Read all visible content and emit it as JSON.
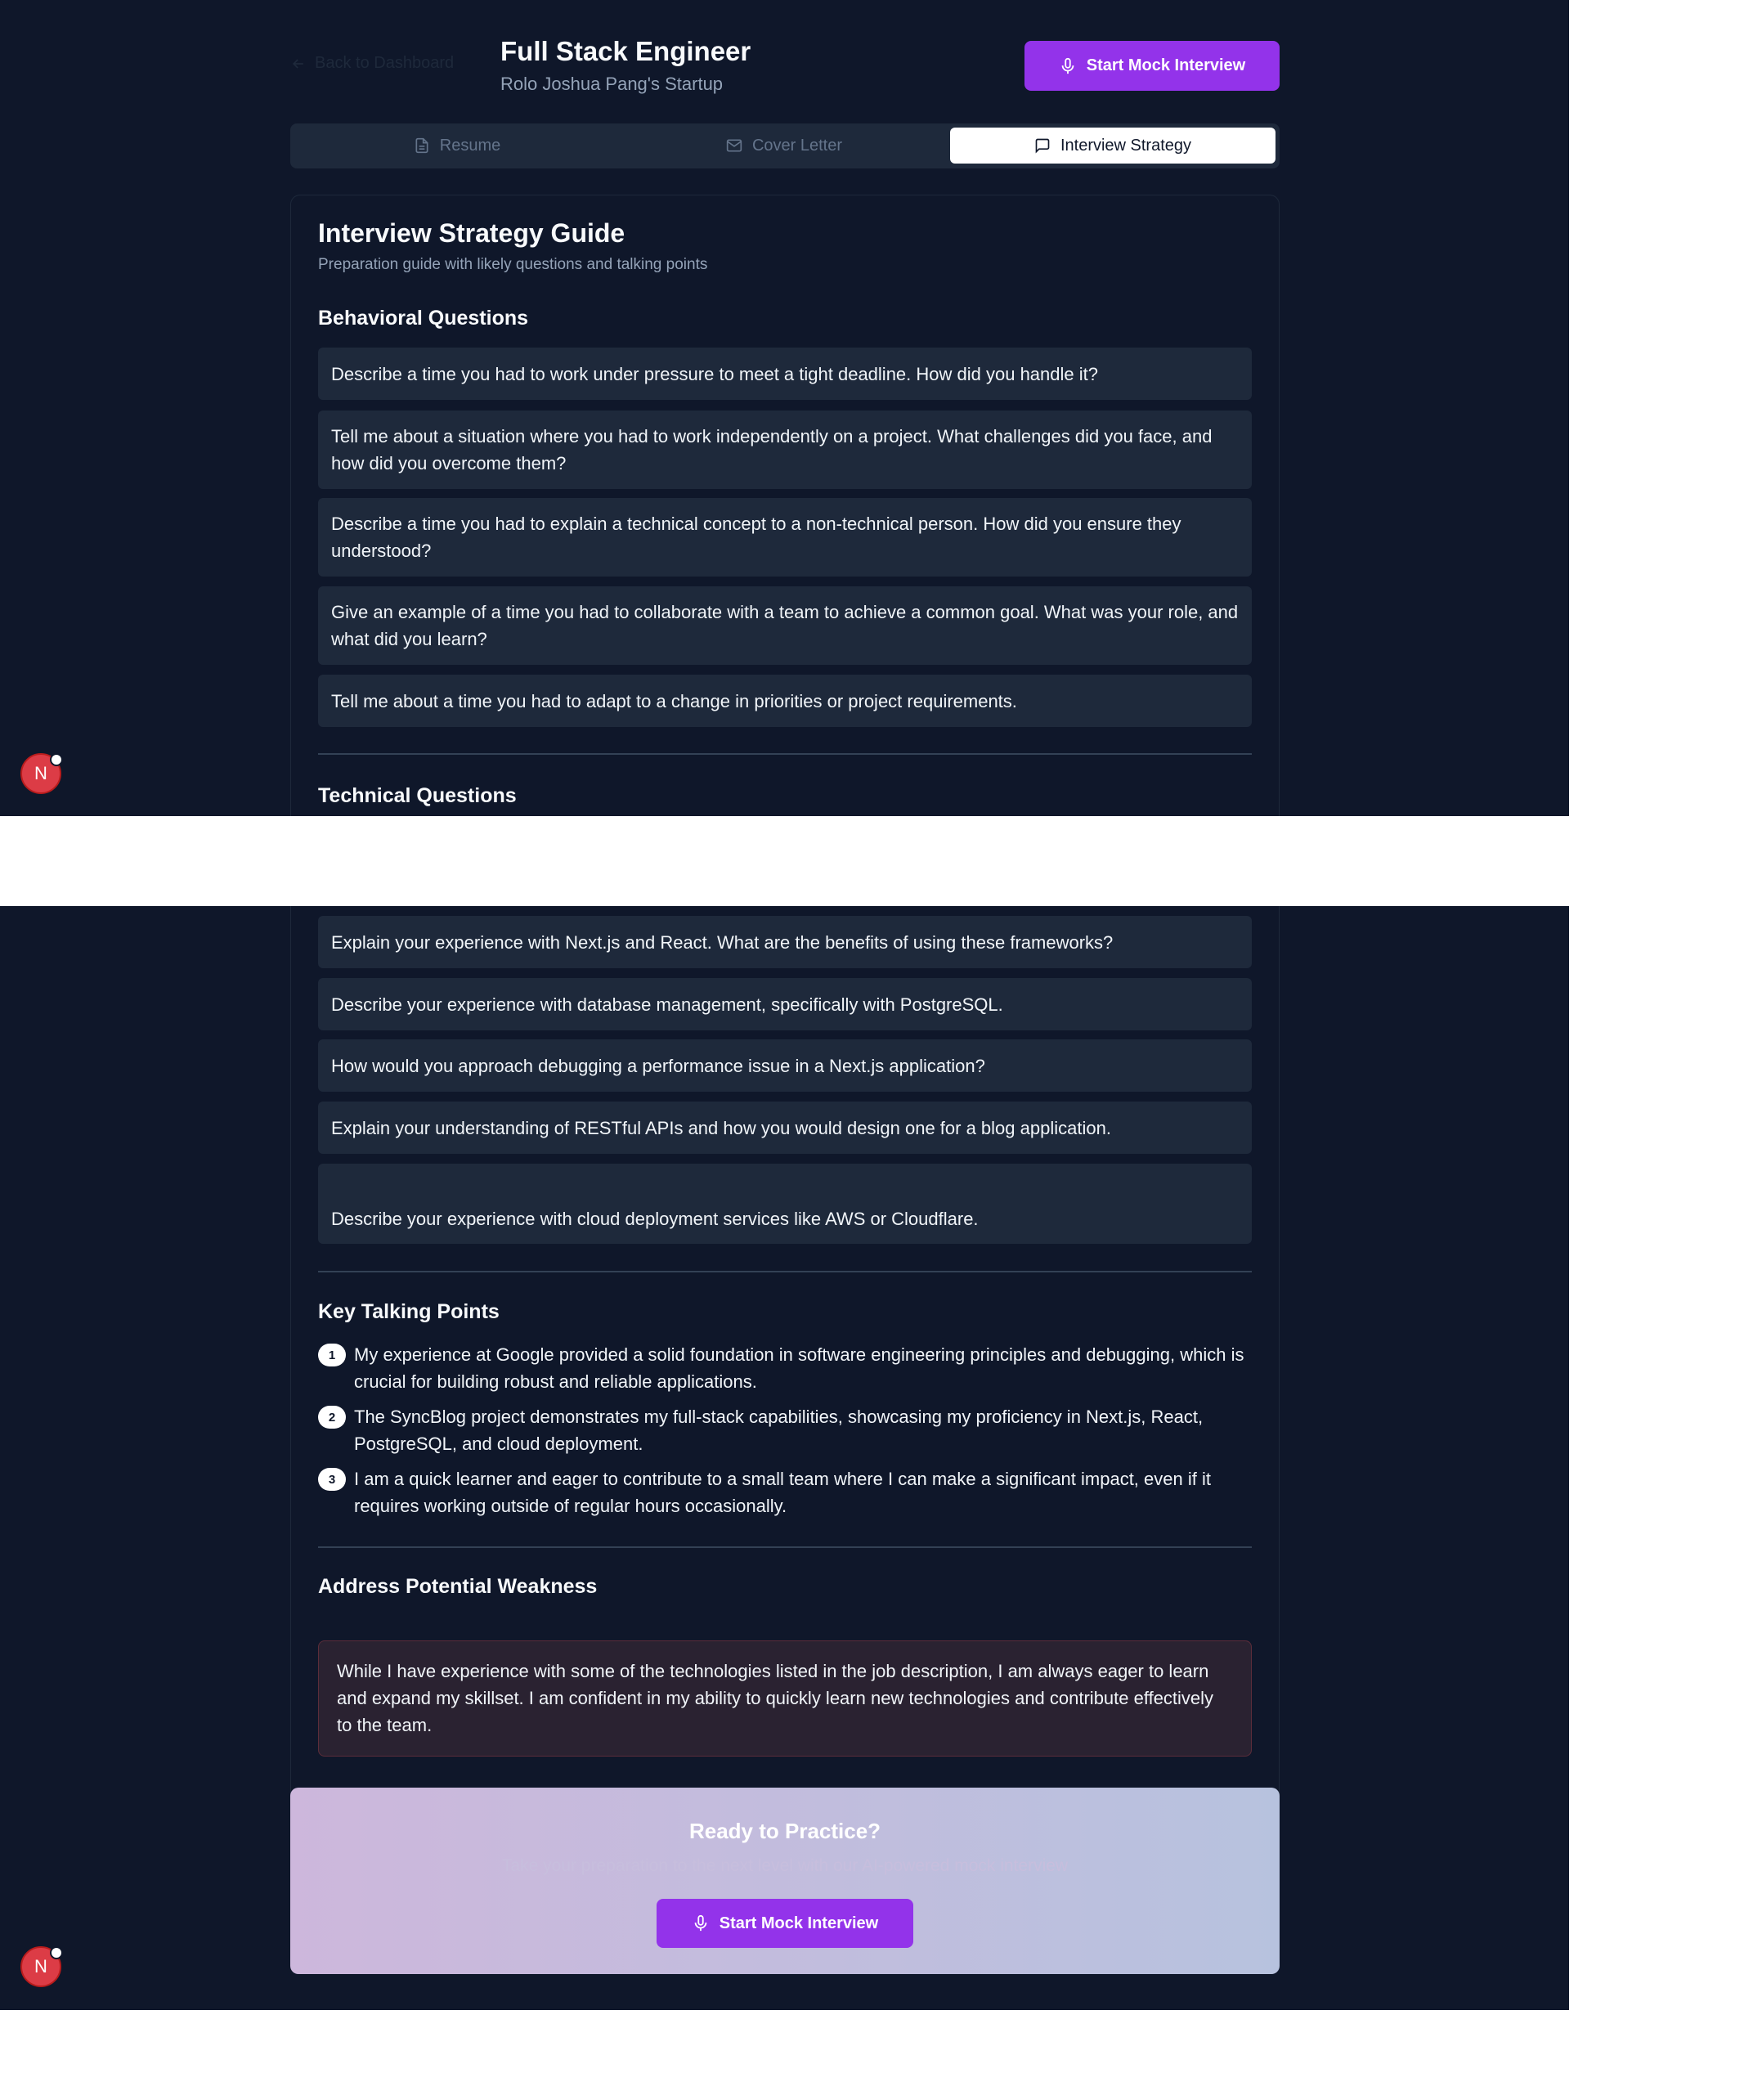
{
  "header": {
    "back_label": "Back to Dashboard",
    "job_title": "Full Stack Engineer",
    "company": "Rolo Joshua Pang's Startup",
    "mock_button": "Start Mock Interview"
  },
  "tabs": [
    {
      "label": "Resume",
      "icon": "file-icon",
      "active": false
    },
    {
      "label": "Cover Letter",
      "icon": "mail-icon",
      "active": false
    },
    {
      "label": "Interview Strategy",
      "icon": "message-icon",
      "active": true
    }
  ],
  "guide": {
    "title": "Interview Strategy Guide",
    "subtitle": "Preparation guide with likely questions and talking points"
  },
  "behavioral": {
    "title": "Behavioral Questions",
    "questions": [
      "Describe a time you had to work under pressure to meet a tight deadline. How did you handle it?",
      "Tell me about a situation where you had to work independently on a project. What challenges did you face, and how did you overcome them?",
      "Describe a time you had to explain a technical concept to a non-technical person. How did you ensure they understood?",
      "Give an example of a time you had to collaborate with a team to achieve a common goal. What was your role, and what did you learn?",
      "Tell me about a time you had to adapt to a change in priorities or project requirements."
    ]
  },
  "technical": {
    "title": "Technical Questions",
    "questions": [
      "Explain your experience with Next.js and React. What are the benefits of using these frameworks?",
      "Describe your experience with database management, specifically with PostgreSQL.",
      "How would you approach debugging a performance issue in a Next.js application?",
      "Explain your understanding of RESTful APIs and how you would design one for a blog application.",
      "Describe your experience with cloud deployment services like AWS or Cloudflare."
    ]
  },
  "talking_points": {
    "title": "Key Talking Points",
    "items": [
      {
        "num": "1",
        "text": "My experience at Google provided a solid foundation in software engineering principles and debugging, which is crucial for building robust and reliable applications."
      },
      {
        "num": "2",
        "text": "The SyncBlog project demonstrates my full-stack capabilities, showcasing my proficiency in Next.js, React, PostgreSQL, and cloud deployment."
      },
      {
        "num": "3",
        "text": "I am a quick learner and eager to contribute to a small team where I can make a significant impact, even if it requires working outside of regular hours occasionally."
      }
    ]
  },
  "weakness": {
    "title": "Address Potential Weakness",
    "text": "While I have experience with some of the technologies listed in the job description, I am always eager to learn and expand my skillset. I am confident in my ability to quickly learn new technologies and contribute effectively to the team."
  },
  "practice": {
    "title": "Ready to Practice?",
    "subtitle": "Take your preparation to the next level with our AI-powered mock interview",
    "button": "Start Mock Interview"
  },
  "avatar": {
    "letter": "N"
  },
  "colors": {
    "page_bg": "#0f172a",
    "accent": "#9333ea",
    "card_item": "#1e293b"
  }
}
